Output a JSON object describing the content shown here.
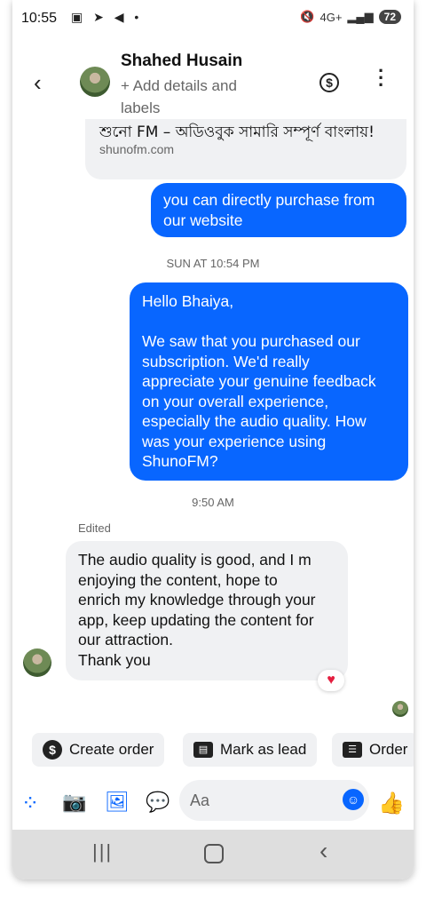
{
  "status": {
    "time": "10:55",
    "left_icons": "▣ ➤ ◀ •",
    "network": "4G+",
    "battery": "72"
  },
  "header": {
    "name": "Shahed Husain",
    "subtitle": "+ Add details and labels"
  },
  "link_preview": {
    "title": "শুনো FM – অডিওবুক সামারি সম্পূর্ণ বাংলায়!",
    "url": "shunofm.com"
  },
  "messages": {
    "m1": "you can directly purchase from\nour website",
    "ts1": "SUN AT 10:54 PM",
    "m2": "Hello Bhaiya,\n\nWe saw that you purchased our\nsubscription. We'd really\nappreciate your genuine feedback\non your overall experience,\nespecially the audio quality. How\nwas your experience using\nShunoFM?",
    "ts2": "9:50 AM",
    "edited": "Edited",
    "m3": "The audio quality is good, and I m\nenjoying the content, hope to\nenrich my knowledge through your\napp, keep updating the content for\nour attraction.\nThank you"
  },
  "quick_actions": [
    {
      "label": "Create order",
      "icon": "dollar-icon"
    },
    {
      "label": "Mark as lead",
      "icon": "contact-card-icon"
    },
    {
      "label": "Order",
      "icon": "document-list-icon"
    }
  ],
  "composer": {
    "placeholder": "Aa"
  },
  "colors": {
    "accent": "#0866ff",
    "bubble_in": "#f0f1f3",
    "heart": "#e41e3f"
  }
}
